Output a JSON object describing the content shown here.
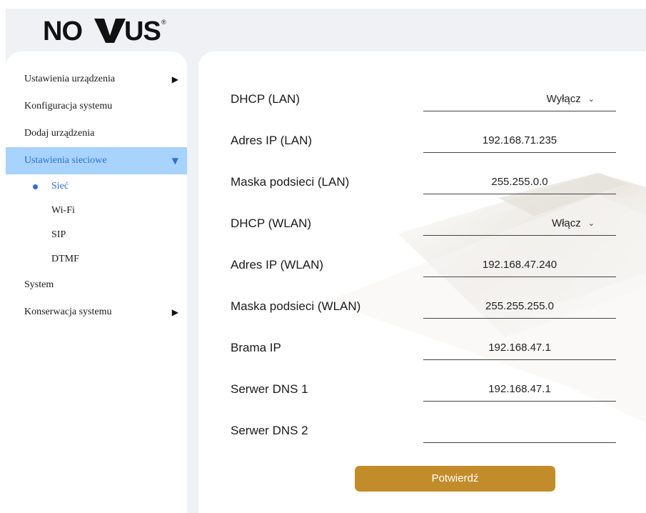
{
  "brand": {
    "logo_text": "NOVUS",
    "logo_mark": "®"
  },
  "sidebar": {
    "items": [
      {
        "label": "Ustawienia urządzenia",
        "arrow": "▶"
      },
      {
        "label": "Konfiguracja systemu"
      },
      {
        "label": "Dodaj urządzenia"
      },
      {
        "label": "Ustawienia sieciowe",
        "arrow": "▼",
        "active": true
      },
      {
        "label": "System"
      },
      {
        "label": "Konserwacja systemu",
        "arrow": "▶"
      }
    ],
    "network_subitems": [
      {
        "label": "Sieć",
        "active": true
      },
      {
        "label": "Wi-Fi"
      },
      {
        "label": "SIP"
      },
      {
        "label": "DTMF"
      }
    ]
  },
  "form": {
    "dhcp_lan": {
      "label": "DHCP (LAN)",
      "value": "Wyłącz"
    },
    "ip_lan": {
      "label": "Adres IP (LAN)",
      "value": "192.168.71.235"
    },
    "mask_lan": {
      "label": "Maska podsieci (LAN)",
      "value": "255.255.0.0"
    },
    "dhcp_wlan": {
      "label": "DHCP (WLAN)",
      "value": "Włącz"
    },
    "ip_wlan": {
      "label": "Adres IP (WLAN)",
      "value": "192.168.47.240"
    },
    "mask_wlan": {
      "label": "Maska podsieci (WLAN)",
      "value": "255.255.255.0"
    },
    "gateway": {
      "label": "Brama IP",
      "value": "192.168.47.1"
    },
    "dns1": {
      "label": "Serwer DNS 1",
      "value": "192.168.47.1"
    },
    "dns2": {
      "label": "Serwer DNS 2",
      "value": ""
    },
    "confirm_label": "Potwierdź"
  },
  "colors": {
    "accent": "#c38c2b",
    "active_bg": "#a7d3fc",
    "active_text": "#2f6fd6",
    "app_bg": "#eff1f5"
  },
  "icons": {
    "collapsed": "triangle-right-icon",
    "expanded": "triangle-down-icon",
    "select": "chevron-down-icon",
    "bullet": "bullet-dot-icon"
  }
}
